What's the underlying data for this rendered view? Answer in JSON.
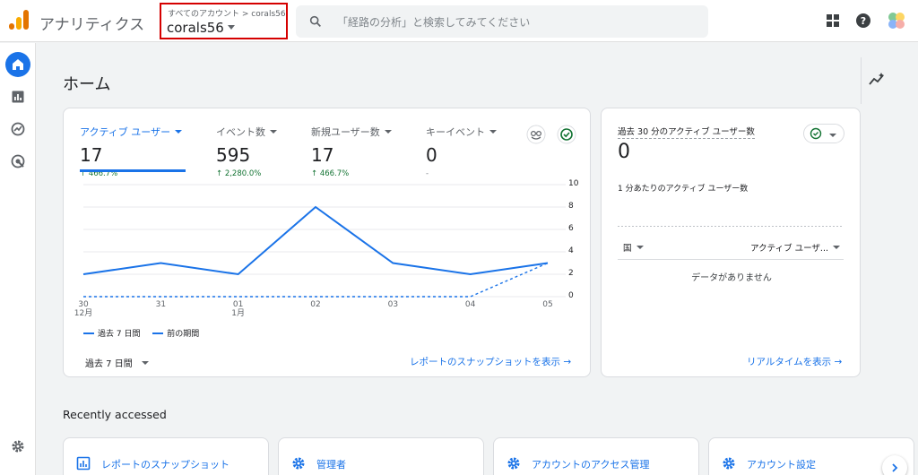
{
  "app": {
    "title": "アナリティクス"
  },
  "account": {
    "breadcrumb": "すべてのアカウント > corals56",
    "name": "corals56"
  },
  "search": {
    "placeholder": "「経路の分析」と検索してみてください"
  },
  "page": {
    "title": "ホーム"
  },
  "metrics": [
    {
      "label": "アクティブ ユーザー",
      "value": "17",
      "change": "↑ 466.7%"
    },
    {
      "label": "イベント数",
      "value": "595",
      "change": "↑ 2,280.0%"
    },
    {
      "label": "新規ユーザー数",
      "value": "17",
      "change": "↑ 466.7%"
    },
    {
      "label": "キーイベント",
      "value": "0",
      "change": "-"
    }
  ],
  "chart_data": {
    "type": "line",
    "categories": [
      "30 12月",
      "31",
      "01 1月",
      "02",
      "03",
      "04",
      "05"
    ],
    "series": [
      {
        "name": "過去 7 日間",
        "values": [
          2,
          3,
          2,
          8,
          3,
          2,
          3
        ]
      },
      {
        "name": "前の期間",
        "values": [
          0,
          0,
          0,
          0,
          0,
          0,
          3
        ]
      }
    ],
    "yticks": [
      "10",
      "8",
      "6",
      "4",
      "2",
      "0"
    ],
    "ylim": [
      0,
      10
    ],
    "legend_position": "bottom-left",
    "grid": true
  },
  "chart_labels": {
    "x": [
      {
        "day": "30",
        "month": "12月"
      },
      {
        "day": "31",
        "month": ""
      },
      {
        "day": "01",
        "month": "1月"
      },
      {
        "day": "02",
        "month": ""
      },
      {
        "day": "03",
        "month": ""
      },
      {
        "day": "04",
        "month": ""
      },
      {
        "day": "05",
        "month": ""
      }
    ]
  },
  "legend": {
    "current": "過去 7 日間",
    "previous": "前の期間"
  },
  "range_selector": {
    "label": "過去 7 日間"
  },
  "links": {
    "snapshot": "レポートのスナップショットを表示 →",
    "realtime": "リアルタイムを表示 →"
  },
  "realtime": {
    "title": "過去 30 分のアクティブ ユーザー数",
    "value": "0",
    "subtitle": "1 分あたりのアクティブ ユーザー数",
    "col_country": "国",
    "col_users": "アクティブ ユーザ...",
    "empty": "データがありません"
  },
  "recent": {
    "title": "Recently accessed",
    "items": [
      "レポートのスナップショット",
      "管理者",
      "アカウントのアクセス管理",
      "アカウント設定"
    ]
  },
  "colors": {
    "accent": "#1a73e8",
    "positive": "#137333",
    "highlight_border": "#d50000"
  }
}
